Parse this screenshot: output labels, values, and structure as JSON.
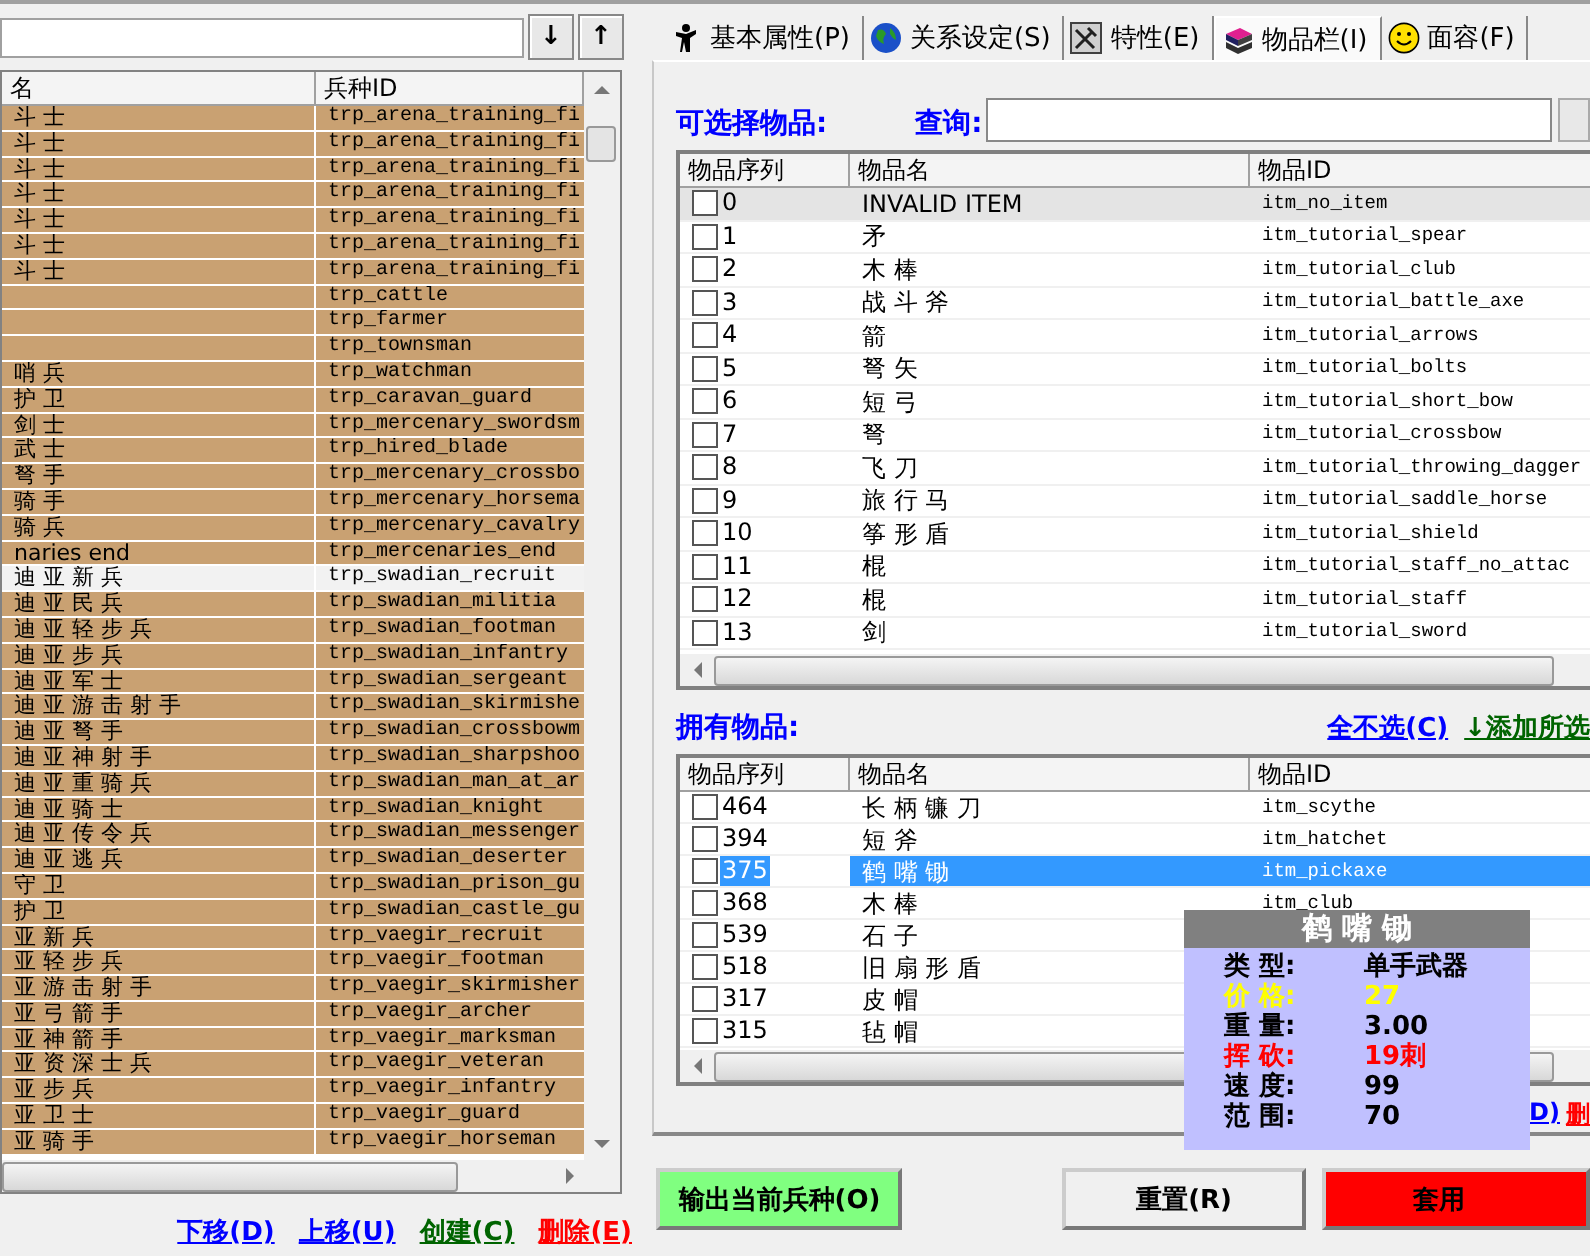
{
  "left": {
    "sort_buttons": [
      "↓",
      "↑"
    ],
    "list": {
      "columns": [
        "名",
        "兵种ID"
      ],
      "rows": [
        {
          "name": "斗 士",
          "id": "trp_arena_training_fi",
          "selected": false
        },
        {
          "name": "斗 士",
          "id": "trp_arena_training_fi",
          "selected": false
        },
        {
          "name": "斗 士",
          "id": "trp_arena_training_fi",
          "selected": false
        },
        {
          "name": "斗 士",
          "id": "trp_arena_training_fi",
          "selected": false
        },
        {
          "name": "斗 士",
          "id": "trp_arena_training_fi",
          "selected": false
        },
        {
          "name": "斗 士",
          "id": "trp_arena_training_fi",
          "selected": false
        },
        {
          "name": "斗 士",
          "id": "trp_arena_training_fi",
          "selected": false
        },
        {
          "id": "trp_cattle",
          "selected": false
        },
        {
          "id": "trp_farmer",
          "selected": false
        },
        {
          "id": "trp_townsman",
          "selected": false
        },
        {
          "name": "哨 兵",
          "id": "trp_watchman",
          "selected": false
        },
        {
          "name": "护 卫",
          "id": "trp_caravan_guard",
          "selected": false
        },
        {
          "name": "剑 士",
          "id": "trp_mercenary_swordsm",
          "selected": false
        },
        {
          "name": "武 士",
          "id": "trp_hired_blade",
          "selected": false
        },
        {
          "name": "弩 手",
          "id": "trp_mercenary_crossbo",
          "selected": false
        },
        {
          "name": "骑 手",
          "id": "trp_mercenary_horsema",
          "selected": false
        },
        {
          "name": "骑 兵",
          "id": "trp_mercenary_cavalry",
          "selected": false
        },
        {
          "name": "naries end",
          "id": "trp_mercenaries_end",
          "selected": false
        },
        {
          "name": "迪 亚 新 兵",
          "id": "trp_swadian_recruit",
          "selected": true
        },
        {
          "name": "迪 亚 民 兵",
          "id": "trp_swadian_militia",
          "selected": false
        },
        {
          "name": "迪 亚 轻 步 兵",
          "id": "trp_swadian_footman",
          "selected": false
        },
        {
          "name": "迪 亚 步 兵",
          "id": "trp_swadian_infantry",
          "selected": false
        },
        {
          "name": "迪 亚 军 士",
          "id": "trp_swadian_sergeant",
          "selected": false
        },
        {
          "name": "迪 亚 游 击 射 手",
          "id": "trp_swadian_skirmishe",
          "selected": false
        },
        {
          "name": "迪 亚 弩 手",
          "id": "trp_swadian_crossbowm",
          "selected": false
        },
        {
          "name": "迪 亚 神 射 手",
          "id": "trp_swadian_sharpshoo",
          "selected": false
        },
        {
          "name": "迪 亚 重 骑 兵",
          "id": "trp_swadian_man_at_ar",
          "selected": false
        },
        {
          "name": "迪 亚 骑 士",
          "id": "trp_swadian_knight",
          "selected": false
        },
        {
          "name": "迪 亚 传 令 兵",
          "id": "trp_swadian_messenger",
          "selected": false
        },
        {
          "name": "迪 亚 逃 兵",
          "id": "trp_swadian_deserter",
          "selected": false
        },
        {
          "name": "守 卫",
          "id": "trp_swadian_prison_gu",
          "selected": false
        },
        {
          "name": "护 卫",
          "id": "trp_swadian_castle_gu",
          "selected": false
        },
        {
          "name": "亚 新 兵",
          "id": "trp_vaegir_recruit",
          "selected": false
        },
        {
          "name": "亚 轻 步 兵",
          "id": "trp_vaegir_footman",
          "selected": false
        },
        {
          "name": "亚 游 击 射 手",
          "id": "trp_vaegir_skirmisher",
          "selected": false
        },
        {
          "name": "亚 弓 箭 手",
          "id": "trp_vaegir_archer",
          "selected": false
        },
        {
          "name": "亚 神 箭 手",
          "id": "trp_vaegir_marksman",
          "selected": false
        },
        {
          "name": "亚 资 深 士 兵",
          "id": "trp_vaegir_veteran",
          "selected": false
        },
        {
          "name": "亚 步 兵",
          "id": "trp_vaegir_infantry",
          "selected": false
        },
        {
          "name": "亚 卫 士",
          "id": "trp_vaegir_guard",
          "selected": false
        },
        {
          "name": "亚 骑 手",
          "id": "trp_vaegir_horseman",
          "selected": false
        }
      ]
    },
    "links": [
      {
        "label": "下移(D)",
        "color": "#0000ff"
      },
      {
        "label": "上移(U)",
        "color": "#0000ff"
      },
      {
        "label": "创建(C)",
        "color": "#006400"
      },
      {
        "label": "删除(E)",
        "color": "#ff0000"
      }
    ]
  },
  "right": {
    "tabs": [
      {
        "label": "基本属性(P)",
        "selected": false
      },
      {
        "label": "关系设定(S)",
        "selected": false
      },
      {
        "label": "特性(E)",
        "selected": false
      },
      {
        "label": "物品栏(I)",
        "selected": true
      },
      {
        "label": "面容(F)",
        "selected": false
      }
    ],
    "available": {
      "title": "可选择物品:",
      "search_label": "查询:",
      "columns": [
        "物品序列",
        "物品名",
        "物品ID"
      ],
      "rows": [
        {
          "index": "0",
          "name": "INVALID ITEM",
          "id": "itm_no_item",
          "checked": false,
          "selected": true
        },
        {
          "index": "1",
          "name": "矛",
          "id": "itm_tutorial_spear",
          "checked": false,
          "selected": false
        },
        {
          "index": "2",
          "name": "木 棒",
          "id": "itm_tutorial_club",
          "checked": false,
          "selected": false
        },
        {
          "index": "3",
          "name": "战 斗 斧",
          "id": "itm_tutorial_battle_axe",
          "checked": false,
          "selected": false
        },
        {
          "index": "4",
          "name": "箭",
          "id": "itm_tutorial_arrows",
          "checked": false,
          "selected": false
        },
        {
          "index": "5",
          "name": "弩 矢",
          "id": "itm_tutorial_bolts",
          "checked": false,
          "selected": false
        },
        {
          "index": "6",
          "name": "短 弓",
          "id": "itm_tutorial_short_bow",
          "checked": false,
          "selected": false
        },
        {
          "index": "7",
          "name": "弩",
          "id": "itm_tutorial_crossbow",
          "checked": false,
          "selected": false
        },
        {
          "index": "8",
          "name": "飞 刀",
          "id": "itm_tutorial_throwing_dagger",
          "checked": false,
          "selected": false
        },
        {
          "index": "9",
          "name": "旅 行 马",
          "id": "itm_tutorial_saddle_horse",
          "checked": false,
          "selected": false
        },
        {
          "index": "10",
          "name": "筝 形 盾",
          "id": "itm_tutorial_shield",
          "checked": false,
          "selected": false
        },
        {
          "index": "11",
          "name": "棍",
          "id": "itm_tutorial_staff_no_attac",
          "checked": false,
          "selected": false
        },
        {
          "index": "12",
          "name": "棍",
          "id": "itm_tutorial_staff",
          "checked": false,
          "selected": false
        },
        {
          "index": "13",
          "name": "剑",
          "id": "itm_tutorial_sword",
          "checked": false,
          "selected": false
        }
      ]
    },
    "owned": {
      "title": "拥有物品:",
      "links": [
        {
          "label": "全不选(C)",
          "color": "#0000ff"
        },
        {
          "label": "↓添加所选",
          "color": "#006400"
        }
      ],
      "columns": [
        "物品序列",
        "物品名",
        "物品ID"
      ],
      "rows": [
        {
          "index": "464",
          "name": "长 柄 镰 刀",
          "id": "itm_scythe",
          "checked": false,
          "selected": false
        },
        {
          "index": "394",
          "name": "短 斧",
          "id": "itm_hatchet",
          "checked": false,
          "selected": false
        },
        {
          "index": "375",
          "name": "鹤 嘴 锄",
          "id": "itm_pickaxe",
          "checked": false,
          "selected": true
        },
        {
          "index": "368",
          "name": "木 棒",
          "id": "itm_club",
          "checked": false,
          "selected": false
        },
        {
          "index": "539",
          "name": "石 子",
          "checked": false,
          "selected": false
        },
        {
          "index": "518",
          "name": "旧 扇 形 盾",
          "checked": false,
          "selected": false
        },
        {
          "index": "317",
          "name": "皮 帽",
          "checked": false,
          "selected": false
        },
        {
          "index": "315",
          "name": "毡 帽",
          "checked": false,
          "selected": false
        }
      ],
      "lower_links": [
        {
          "label": "D)",
          "color": "#0000ff"
        },
        {
          "label": "删",
          "color": "#ff0000"
        }
      ]
    },
    "tooltip": {
      "title": "鹤 嘴 锄",
      "rows": [
        {
          "label": "类 型:",
          "value": "单手武器",
          "color": "#000000"
        },
        {
          "label": "价 格:",
          "value": "27",
          "color": "#ffff00"
        },
        {
          "label": "重 量:",
          "value": "3.00",
          "color": "#000000"
        },
        {
          "label": "挥 砍:",
          "value": "19刺",
          "color": "#ff0000"
        },
        {
          "label": "速 度:",
          "value": "99",
          "color": "#000000"
        },
        {
          "label": "范 围:",
          "value": "70",
          "color": "#000000"
        }
      ]
    },
    "buttons": [
      {
        "label": "输出当前兵种(O)",
        "color": "#80ff80"
      },
      {
        "label": "重置(R)",
        "color": "#f0f0f0"
      },
      {
        "label": "套用",
        "color": "#ff0000"
      }
    ]
  }
}
